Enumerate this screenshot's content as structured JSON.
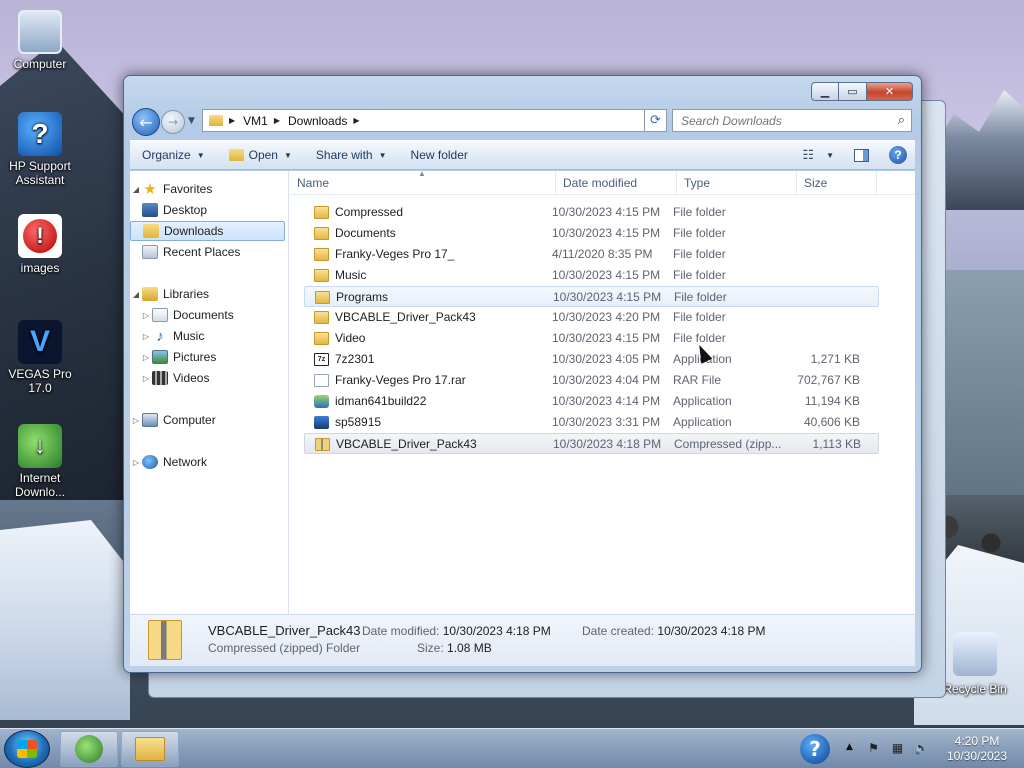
{
  "desktop": {
    "icons": [
      {
        "label": "Computer"
      },
      {
        "label": "HP Support Assistant"
      },
      {
        "label": "images"
      },
      {
        "label": "VEGAS Pro 17.0"
      },
      {
        "label": "Internet Downlo..."
      },
      {
        "label": "Recycle Bin"
      }
    ]
  },
  "window": {
    "address": {
      "parts": [
        "VM1",
        "Downloads"
      ]
    },
    "search": {
      "placeholder": "Search Downloads"
    },
    "toolbar": {
      "organize": "Organize",
      "open": "Open",
      "share_with": "Share with",
      "new_folder": "New folder"
    },
    "nav_pane": {
      "favorites": "Favorites",
      "desktop": "Desktop",
      "downloads": "Downloads",
      "recent_places": "Recent Places",
      "libraries": "Libraries",
      "documents": "Documents",
      "music": "Music",
      "pictures": "Pictures",
      "videos": "Videos",
      "computer": "Computer",
      "network": "Network"
    },
    "columns": {
      "name": "Name",
      "date_modified": "Date modified",
      "type": "Type",
      "size": "Size"
    },
    "files": [
      {
        "name": "Compressed",
        "date": "10/30/2023 4:15 PM",
        "type": "File folder",
        "size": ""
      },
      {
        "name": "Documents",
        "date": "10/30/2023 4:15 PM",
        "type": "File folder",
        "size": ""
      },
      {
        "name": "Franky-Veges Pro 17_",
        "date": "4/11/2020 8:35 PM",
        "type": "File folder",
        "size": ""
      },
      {
        "name": "Music",
        "date": "10/30/2023 4:15 PM",
        "type": "File folder",
        "size": ""
      },
      {
        "name": "Programs",
        "date": "10/30/2023 4:15 PM",
        "type": "File folder",
        "size": ""
      },
      {
        "name": "VBCABLE_Driver_Pack43",
        "date": "10/30/2023 4:20 PM",
        "type": "File folder",
        "size": ""
      },
      {
        "name": "Video",
        "date": "10/30/2023 4:15 PM",
        "type": "File folder",
        "size": ""
      },
      {
        "name": "7z2301",
        "date": "10/30/2023 4:05 PM",
        "type": "Application",
        "size": "1,271 KB"
      },
      {
        "name": "Franky-Veges Pro 17.rar",
        "date": "10/30/2023 4:04 PM",
        "type": "RAR File",
        "size": "702,767 KB"
      },
      {
        "name": "idman641build22",
        "date": "10/30/2023 4:14 PM",
        "type": "Application",
        "size": "11,194 KB"
      },
      {
        "name": "sp58915",
        "date": "10/30/2023 3:31 PM",
        "type": "Application",
        "size": "40,606 KB"
      },
      {
        "name": "VBCABLE_Driver_Pack43",
        "date": "10/30/2023 4:18 PM",
        "type": "Compressed (zipp...",
        "size": "1,113 KB"
      }
    ],
    "details": {
      "name": "VBCABLE_Driver_Pack43",
      "type": "Compressed (zipped) Folder",
      "date_modified_label": "Date modified:",
      "date_modified": "10/30/2023 4:18 PM",
      "size_label": "Size:",
      "size": "1.08 MB",
      "date_created_label": "Date created:",
      "date_created": "10/30/2023 4:18 PM"
    }
  },
  "taskbar": {
    "time": "4:20 PM",
    "date": "10/30/2023"
  }
}
